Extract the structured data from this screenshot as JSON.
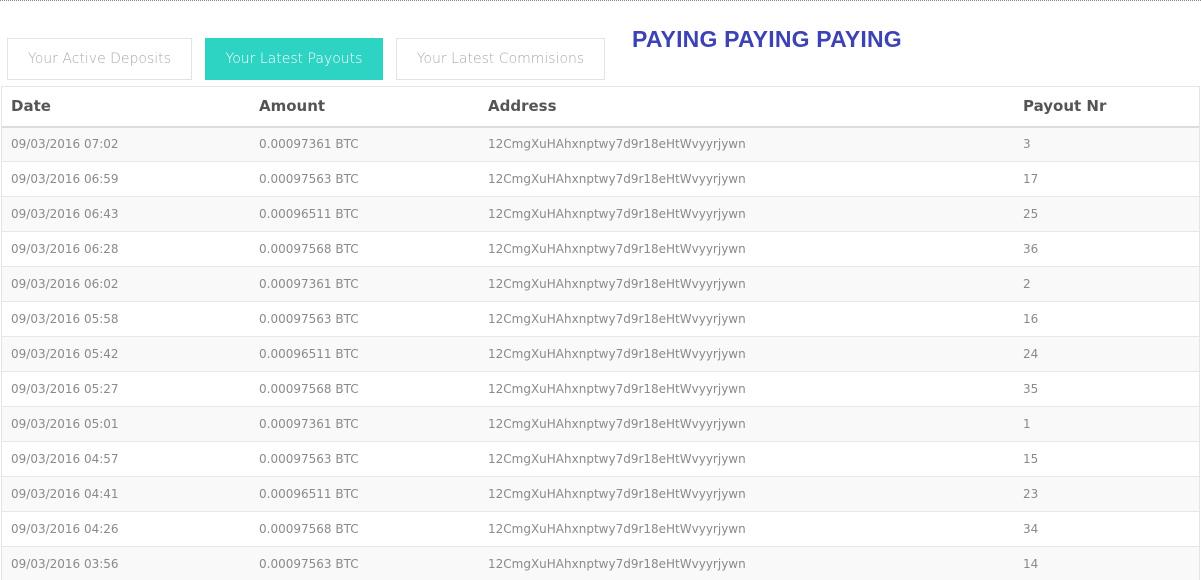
{
  "tabs": [
    {
      "label": "Your Active Deposits",
      "active": false
    },
    {
      "label": "Your Latest Payouts",
      "active": true
    },
    {
      "label": "Your Latest Commisions",
      "active": false
    }
  ],
  "banner": "PAYING PAYING PAYING",
  "colors": {
    "active_tab": "#2dd3c3",
    "banner": "#3d43b4"
  },
  "table": {
    "headers": [
      "Date",
      "Amount",
      "Address",
      "Payout Nr"
    ],
    "rows": [
      [
        "09/03/2016 07:02",
        "0.00097361 BTC",
        "12CmgXuHAhxnptwy7d9r18eHtWvyyrjywn",
        "3"
      ],
      [
        "09/03/2016 06:59",
        "0.00097563 BTC",
        "12CmgXuHAhxnptwy7d9r18eHtWvyyrjywn",
        "17"
      ],
      [
        "09/03/2016 06:43",
        "0.00096511 BTC",
        "12CmgXuHAhxnptwy7d9r18eHtWvyyrjywn",
        "25"
      ],
      [
        "09/03/2016 06:28",
        "0.00097568 BTC",
        "12CmgXuHAhxnptwy7d9r18eHtWvyyrjywn",
        "36"
      ],
      [
        "09/03/2016 06:02",
        "0.00097361 BTC",
        "12CmgXuHAhxnptwy7d9r18eHtWvyyrjywn",
        "2"
      ],
      [
        "09/03/2016 05:58",
        "0.00097563 BTC",
        "12CmgXuHAhxnptwy7d9r18eHtWvyyrjywn",
        "16"
      ],
      [
        "09/03/2016 05:42",
        "0.00096511 BTC",
        "12CmgXuHAhxnptwy7d9r18eHtWvyyrjywn",
        "24"
      ],
      [
        "09/03/2016 05:27",
        "0.00097568 BTC",
        "12CmgXuHAhxnptwy7d9r18eHtWvyyrjywn",
        "35"
      ],
      [
        "09/03/2016 05:01",
        "0.00097361 BTC",
        "12CmgXuHAhxnptwy7d9r18eHtWvyyrjywn",
        "1"
      ],
      [
        "09/03/2016 04:57",
        "0.00097563 BTC",
        "12CmgXuHAhxnptwy7d9r18eHtWvyyrjywn",
        "15"
      ],
      [
        "09/03/2016 04:41",
        "0.00096511 BTC",
        "12CmgXuHAhxnptwy7d9r18eHtWvyyrjywn",
        "23"
      ],
      [
        "09/03/2016 04:26",
        "0.00097568 BTC",
        "12CmgXuHAhxnptwy7d9r18eHtWvyyrjywn",
        "34"
      ],
      [
        "09/03/2016 03:56",
        "0.00097563 BTC",
        "12CmgXuHAhxnptwy7d9r18eHtWvyyrjywn",
        "14"
      ]
    ]
  }
}
